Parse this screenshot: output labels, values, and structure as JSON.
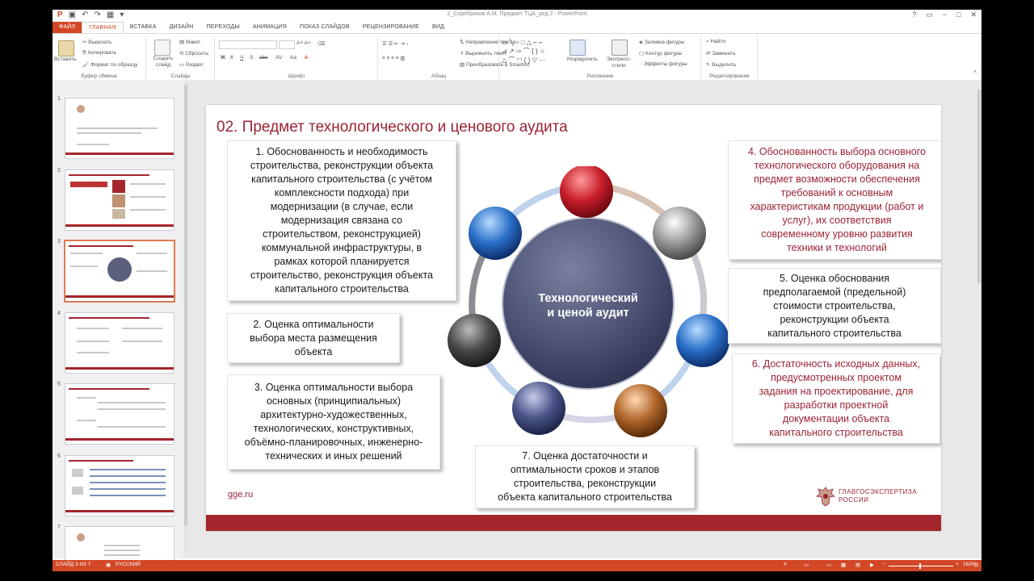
{
  "window": {
    "title": "2_Серебряков А.М. Предмет ТЦА_ред 2 - PowerPoint",
    "help": "?",
    "controls": [
      "−",
      "□",
      "✕"
    ]
  },
  "ribbon": {
    "tabs": [
      "ФАЙЛ",
      "ГЛАВНАЯ",
      "ВСТАВКА",
      "ДИЗАЙН",
      "ПЕРЕХОДЫ",
      "АНИМАЦИЯ",
      "ПОКАЗ СЛАЙДОВ",
      "РЕЦЕНЗИРОВАНИЕ",
      "ВИД"
    ],
    "clipboard": {
      "paste": "Вставить",
      "cut": "Вырезать",
      "copy": "Копировать",
      "format": "Формат по образцу",
      "label": "Буфер обмена"
    },
    "slides": {
      "new": "Создать слайд",
      "layout": "Макет",
      "reset": "Сбросить",
      "section": "Раздел",
      "label": "Слайды"
    },
    "font": {
      "label": "Шрифт",
      "bold": "Ж",
      "italic": "К",
      "underline": "Ч",
      "shadow": "S",
      "strike": "abc",
      "spacing": "AV",
      "case": "Aa",
      "color": "A"
    },
    "paragraph": {
      "direction": "Направление текста",
      "align": "Выровнять текст",
      "smartart": "Преобразовать в SmartArt",
      "label": "Абзац"
    },
    "drawing": {
      "arrange": "Упорядочить",
      "styles": "Экспресс-стили",
      "fill": "Заливка фигуры",
      "outline": "Контур фигуры",
      "effects": "Эффекты фигуры",
      "label": "Рисование"
    },
    "editing": {
      "find": "Найти",
      "replace": "Заменить",
      "select": "Выделить",
      "label": "Редактирование"
    }
  },
  "thumbnails": [
    "1",
    "2",
    "3",
    "4",
    "5",
    "6",
    "7"
  ],
  "slide": {
    "title": "02.  Предмет технологического и ценового аудита",
    "center": [
      "Технологический",
      "и ценой аудит"
    ],
    "boxes": [
      {
        "lines": [
          "1. Обоснованность и необходимость",
          "строительства, реконструкции объекта",
          "капитального строительства (с учётом",
          "комплексности подхода) при",
          "модернизации (в случае, если",
          "модернизация связана со",
          "строительством, реконструкцией)",
          "коммунальной инфраструктуры, в",
          "рамках которой планируется",
          "строительство, реконструкция объекта",
          "капитального строительства"
        ]
      },
      {
        "lines": [
          "2. Оценка оптимальности",
          "выбора места размещения",
          "объекта"
        ]
      },
      {
        "lines": [
          "3. Оценка оптимальности выбора",
          "основных (принципиальных)",
          "архитектурно-художественных,",
          "технологических, конструктивных,",
          "объёмно-планировочных, инженерно-",
          "технических и иных решений"
        ]
      },
      {
        "lines": [
          "4. Обоснованность выбора основного",
          "технологического оборудования на",
          "предмет возможности обеспечения",
          "требований к основным",
          "характеристикам продукции (работ и",
          "услуг), их соответствия",
          "современному уровню развития",
          "техники и технологий"
        ]
      },
      {
        "lines": [
          "5. Оценка обоснования",
          "предполагаемой (предельной)",
          "стоимости строительства,",
          "реконструкции объекта",
          "капитального строительства"
        ]
      },
      {
        "lines": [
          "6. Достаточность исходных данных,",
          "предусмотренных проектом",
          "задания на проектирование, для",
          "разработки проектной",
          "документации объекта",
          "капитального строительства"
        ]
      },
      {
        "lines": [
          "7. Оценка достаточности и",
          "оптимальности сроков и этапов",
          "строительства, реконструкции",
          "объекта капитального строительства"
        ]
      }
    ],
    "website": "gge.ru",
    "logo": [
      "ГЛАВГОСЭКСПЕРТИЗА",
      "РОССИИ"
    ],
    "colors": {
      "accent": "#9b2335",
      "band": "#a4262c"
    }
  },
  "status": {
    "slide": "СЛАЙД 3 ИЗ 7",
    "language": "РУССКИЙ",
    "zoom": "163%"
  }
}
